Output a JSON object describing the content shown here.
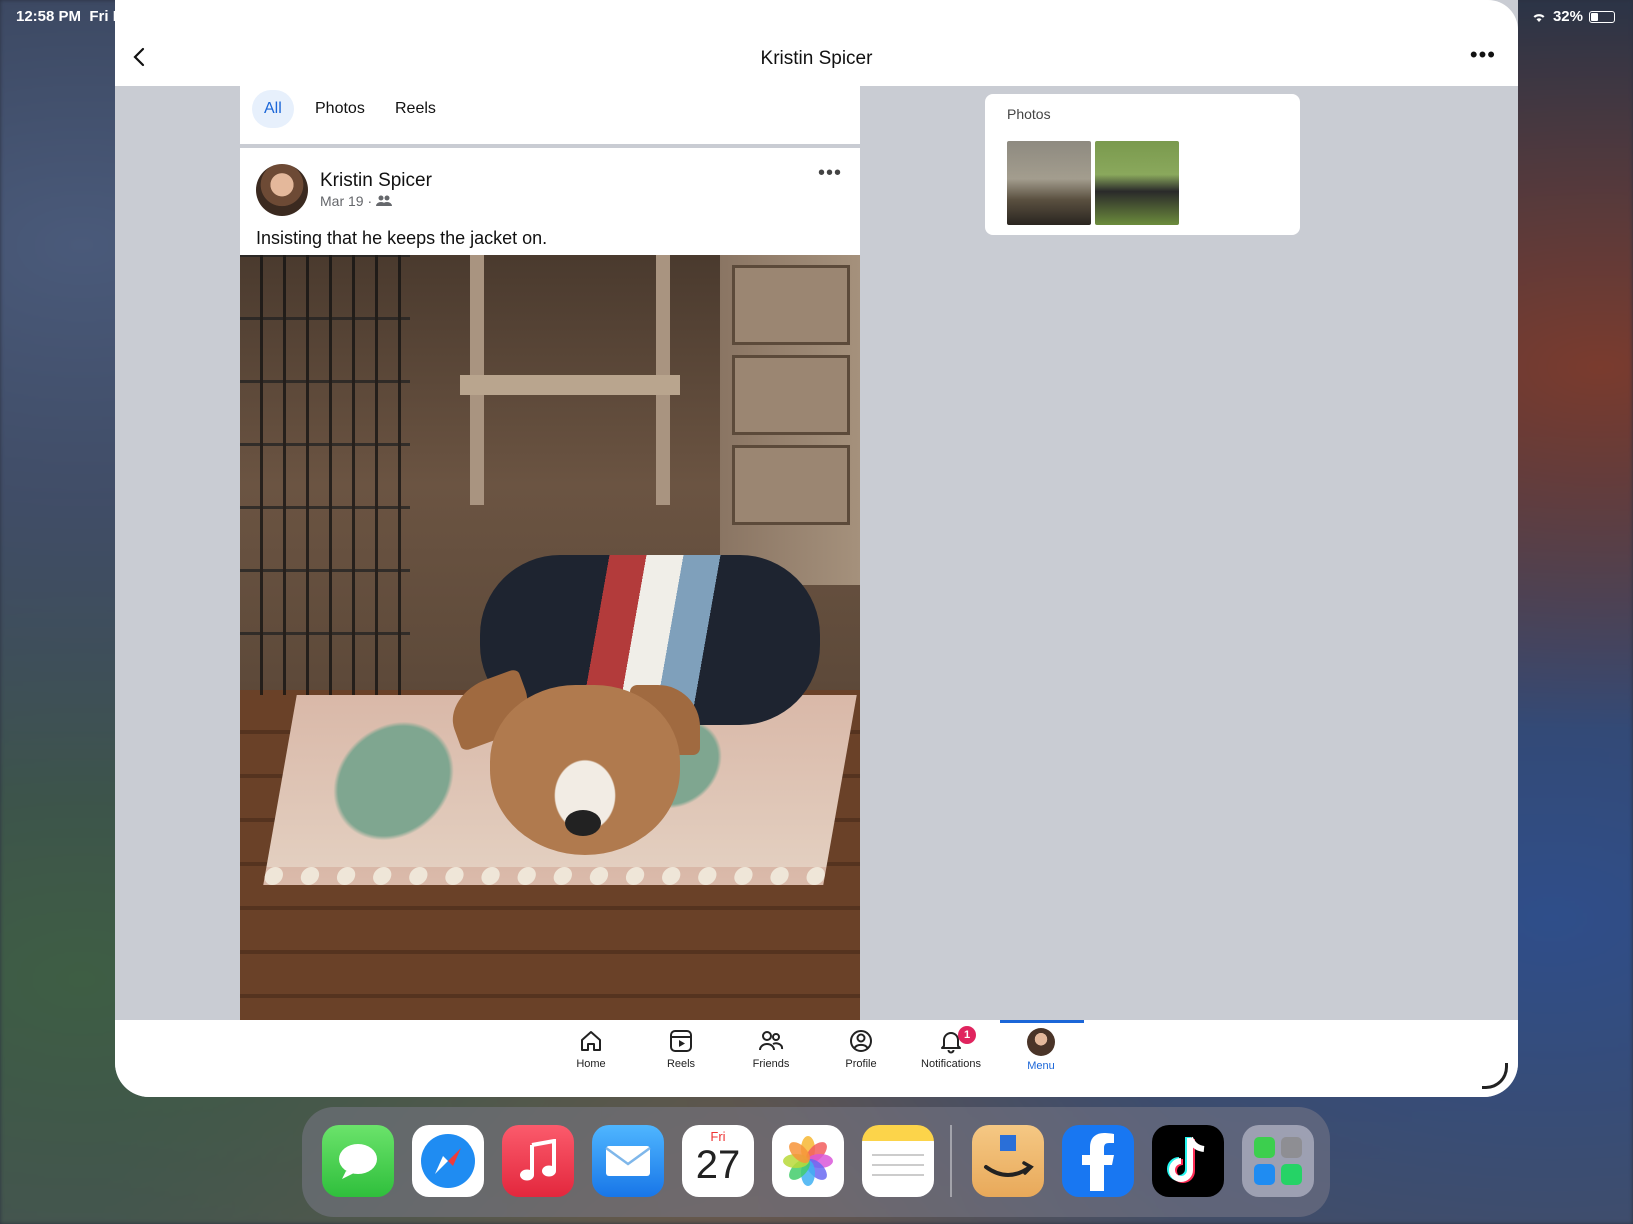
{
  "status_bar": {
    "time": "12:58 PM",
    "date": "Fri M",
    "battery": "32%"
  },
  "header": {
    "title": "Kristin Spicer",
    "back_icon": "chevron-left-icon",
    "more_label": "•••"
  },
  "tabs": [
    {
      "label": "All",
      "active": true
    },
    {
      "label": "Photos",
      "active": false
    },
    {
      "label": "Reels",
      "active": false
    }
  ],
  "post": {
    "author": "Kristin Spicer",
    "date": "Mar 19 ·",
    "privacy_icon": "friends-icon",
    "more_label": "•••",
    "text": "Insisting that he keeps the jacket on."
  },
  "side_card": {
    "title": "Photos"
  },
  "bottom_nav": [
    {
      "label": "Home",
      "icon": "home-icon"
    },
    {
      "label": "Reels",
      "icon": "reels-icon"
    },
    {
      "label": "Friends",
      "icon": "friends-icon"
    },
    {
      "label": "Profile",
      "icon": "profile-icon"
    },
    {
      "label": "Notifications",
      "icon": "bell-icon",
      "badge": "1"
    },
    {
      "label": "Menu",
      "icon": "avatar",
      "active": true
    }
  ],
  "dock": {
    "calendar_day": "Fri",
    "calendar_date": "27",
    "apps": [
      "Messages",
      "Safari",
      "Music",
      "Mail",
      "Calendar",
      "Photos",
      "Notes",
      "Amazon",
      "Facebook",
      "TikTok",
      "App Library"
    ]
  },
  "colors": {
    "accent": "#1b66d8",
    "badge": "#e0245e",
    "canvas": "#c9ccd3"
  }
}
